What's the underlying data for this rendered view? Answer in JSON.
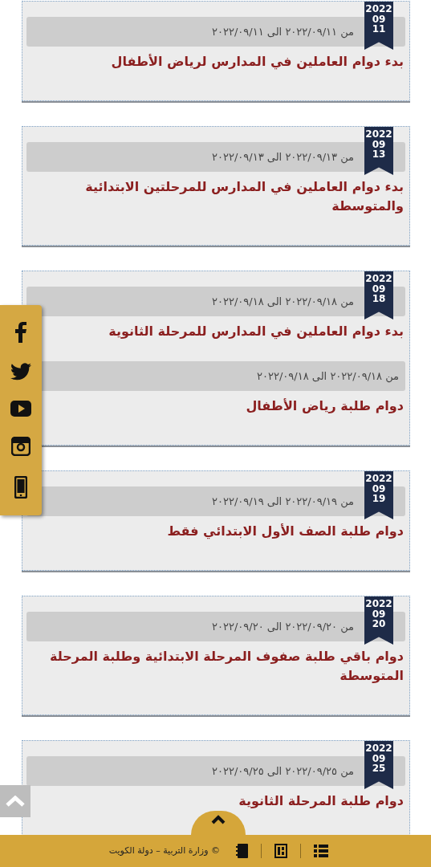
{
  "days": [
    {
      "year": "2022",
      "month": "09",
      "day": "11",
      "events": [
        {
          "range": "من ٢٠٢٢/٠٩/١١ الى ٢٠٢٢/٠٩/١١",
          "title": "بدء دوام العاملين في المدارس لرياض الأطفال"
        }
      ]
    },
    {
      "year": "2022",
      "month": "09",
      "day": "13",
      "events": [
        {
          "range": "من ٢٠٢٢/٠٩/١٣ الى ٢٠٢٢/٠٩/١٣",
          "title": "بدء دوام العاملين في المدارس للمرحلتين الابتدائية والمتوسطة"
        }
      ]
    },
    {
      "year": "2022",
      "month": "09",
      "day": "18",
      "events": [
        {
          "range": "من ٢٠٢٢/٠٩/١٨ الى ٢٠٢٢/٠٩/١٨",
          "title": "بدء دوام العاملين في المدارس للمرحلة الثانوية"
        },
        {
          "range": "من ٢٠٢٢/٠٩/١٨ الى ٢٠٢٢/٠٩/١٨",
          "title": "دوام طلبة رياض الأطفال"
        }
      ]
    },
    {
      "year": "2022",
      "month": "09",
      "day": "19",
      "events": [
        {
          "range": "من ٢٠٢٢/٠٩/١٩ الى ٢٠٢٢/٠٩/١٩",
          "title": "دوام طلبة الصف الأول الابتدائي فقط"
        }
      ]
    },
    {
      "year": "2022",
      "month": "09",
      "day": "20",
      "events": [
        {
          "range": "من ٢٠٢٢/٠٩/٢٠ الى ٢٠٢٢/٠٩/٢٠",
          "title": "دوام باقي طلبة صفوف المرحلة الابتدائية وطلبة المرحلة المتوسطة"
        }
      ]
    },
    {
      "year": "2022",
      "month": "09",
      "day": "25",
      "events": [
        {
          "range": "من ٢٠٢٢/٠٩/٢٥ الى ٢٠٢٢/٠٩/٢٥",
          "title": "دوام طلبة المرحلة الثانوية"
        }
      ]
    }
  ],
  "social_sidebar": [
    {
      "kind": "facebook"
    },
    {
      "kind": "twitter"
    },
    {
      "kind": "youtube"
    },
    {
      "kind": "instagram"
    },
    {
      "kind": "phone"
    }
  ],
  "footer": {
    "copyright": "© وزارة التربية – دولة الكويت",
    "icons": [
      {
        "kind": "list"
      },
      {
        "kind": "layout"
      },
      {
        "kind": "notebook"
      }
    ]
  }
}
